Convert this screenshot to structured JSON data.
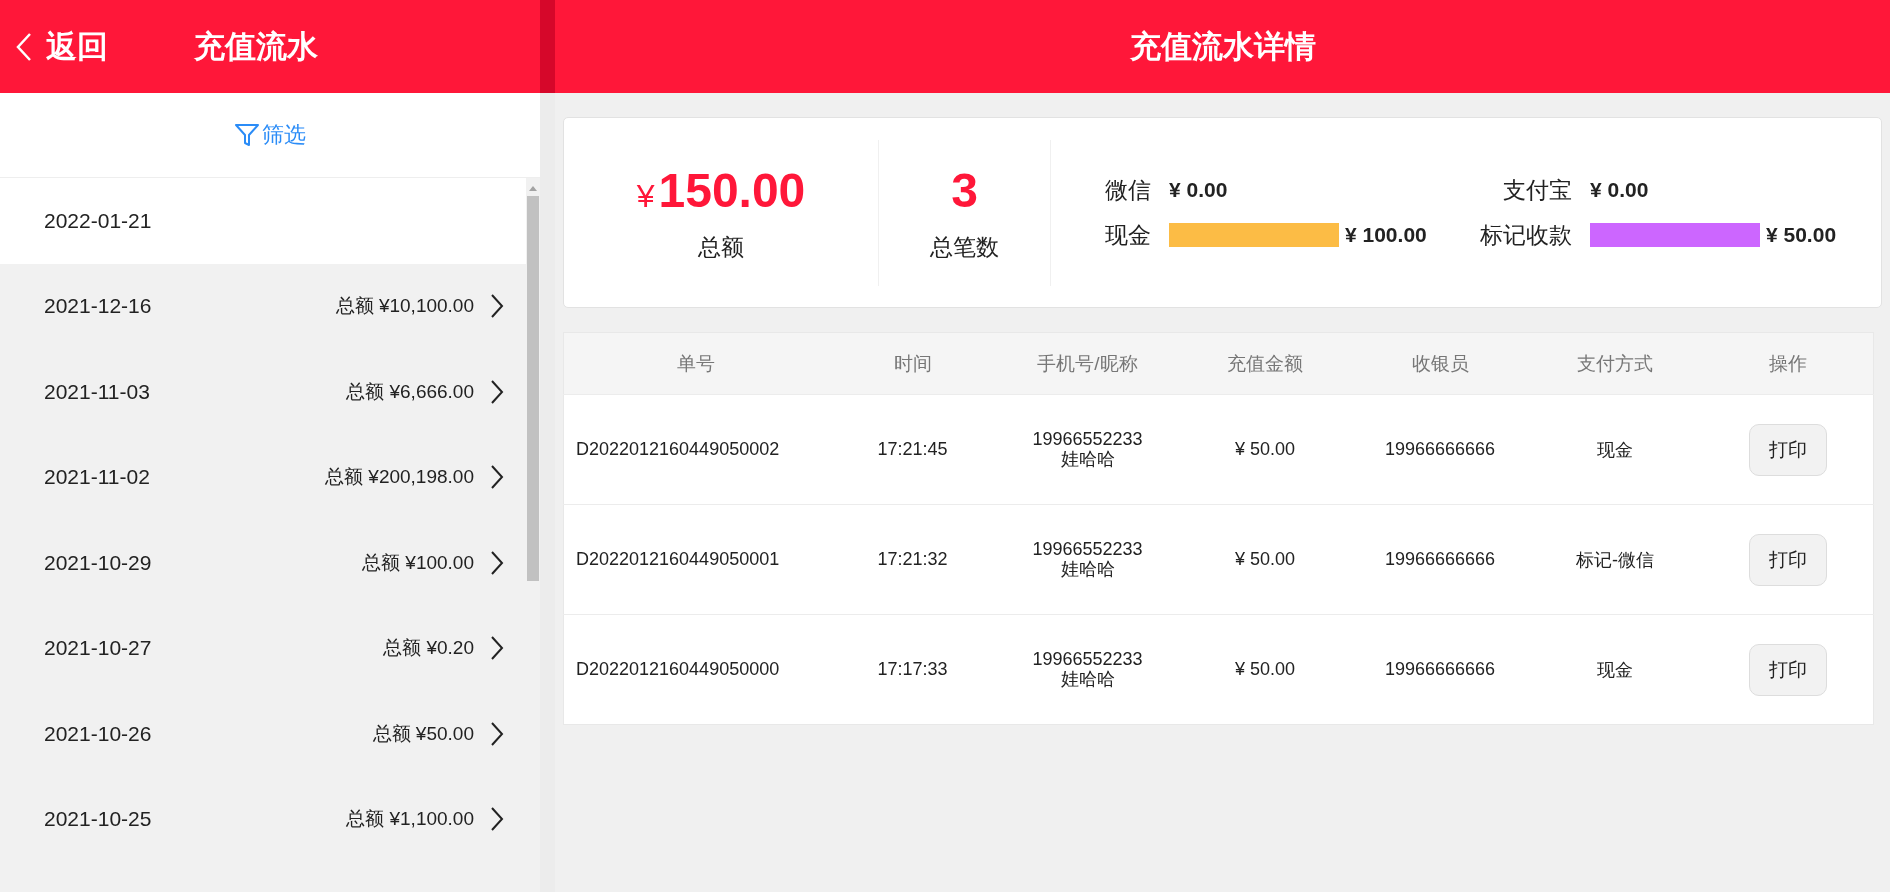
{
  "left_header": {
    "back": "返回",
    "title": "充值流水"
  },
  "filter": {
    "label": "筛选"
  },
  "dates": [
    {
      "date": "2022-01-21",
      "selected": true
    },
    {
      "date": "2021-12-16",
      "total": "总额 ¥10,100.00",
      "selected": false
    },
    {
      "date": "2021-11-03",
      "total": "总额 ¥6,666.00",
      "selected": false
    },
    {
      "date": "2021-11-02",
      "total": "总额 ¥200,198.00",
      "selected": false
    },
    {
      "date": "2021-10-29",
      "total": "总额 ¥100.00",
      "selected": false
    },
    {
      "date": "2021-10-27",
      "total": "总额 ¥0.20",
      "selected": false
    },
    {
      "date": "2021-10-26",
      "total": "总额 ¥50.00",
      "selected": false
    },
    {
      "date": "2021-10-25",
      "total": "总额 ¥1,100.00",
      "selected": false
    }
  ],
  "right_header": {
    "title": "充值流水详情"
  },
  "summary": {
    "currency": "¥",
    "total": "150.00",
    "total_label": "总额",
    "count": "3",
    "count_label": "总笔数",
    "methods": [
      {
        "label": "微信",
        "amount": "¥ 0.00"
      },
      {
        "label": "支付宝",
        "amount": "¥ 0.00"
      },
      {
        "label": "现金",
        "amount": "¥ 100.00",
        "color": "#fcbc45"
      },
      {
        "label": "标记收款",
        "amount": "¥ 50.00",
        "color": "#cc66ff"
      }
    ]
  },
  "table": {
    "columns": [
      "单号",
      "时间",
      "手机号/昵称",
      "充值金额",
      "收银员",
      "支付方式",
      "操作"
    ],
    "rows": [
      {
        "order": "D2022012160449050002",
        "time": "17:21:45",
        "phone": "19966552233",
        "nickname": "娃哈哈",
        "amount": "¥ 50.00",
        "cashier": "19966666666",
        "method": "现金",
        "action": "打印"
      },
      {
        "order": "D2022012160449050001",
        "time": "17:21:32",
        "phone": "19966552233",
        "nickname": "娃哈哈",
        "amount": "¥ 50.00",
        "cashier": "19966666666",
        "method": "标记-微信",
        "action": "打印"
      },
      {
        "order": "D2022012160449050000",
        "time": "17:17:33",
        "phone": "19966552233",
        "nickname": "娃哈哈",
        "amount": "¥ 50.00",
        "cashier": "19966666666",
        "method": "现金",
        "action": "打印"
      }
    ]
  }
}
